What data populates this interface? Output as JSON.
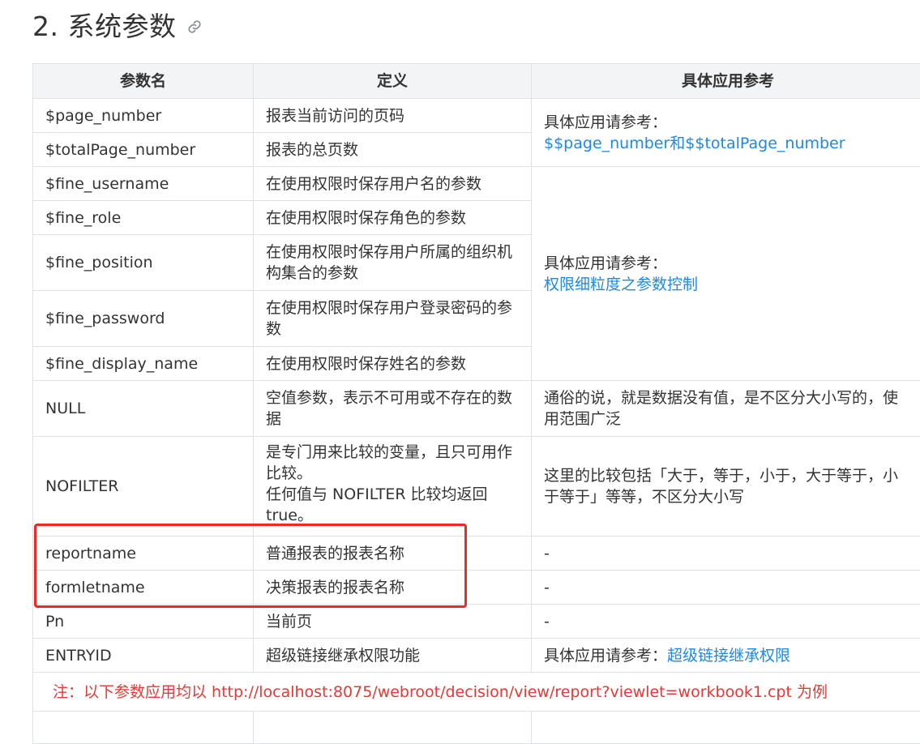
{
  "section": {
    "title": "2. 系统参数",
    "anchor_icon": "link-icon"
  },
  "table": {
    "headers": [
      "参数名",
      "定义",
      "具体应用参考"
    ],
    "refs": {
      "page": {
        "label": "具体应用请参考：",
        "link": "$$page_number和$$totalPage_number"
      },
      "fine": {
        "label": "具体应用请参考：",
        "link": "权限细粒度之参数控制"
      },
      "null": "通俗的说，就是数据没有值，是不区分大小写的，使用范围广泛",
      "nofilter": "这里的比较包括「大于，等于，小于，大于等于，小于等于」等等，不区分大小写",
      "reportname": "-",
      "formletname": "-",
      "pn": "-",
      "entryid": {
        "label": "具体应用请参考：",
        "link": "超级链接继承权限"
      }
    },
    "rows": [
      {
        "name": "$page_number",
        "def": "报表当前访问的页码"
      },
      {
        "name": "$totalPage_number",
        "def": "报表的总页数"
      },
      {
        "name": "$fine_username",
        "def": "在使用权限时保存用户名的参数"
      },
      {
        "name": "$fine_role",
        "def": "在使用权限时保存角色的参数"
      },
      {
        "name": "$fine_position",
        "def": "在使用权限时保存用户所属的组织机构集合的参数"
      },
      {
        "name": "$fine_password",
        "def": "在使用权限时保存用户登录密码的参数"
      },
      {
        "name": "$fine_display_name",
        "def": "在使用权限时保存姓名的参数"
      },
      {
        "name": "NULL",
        "def": "空值参数，表示不可用或不存在的数据"
      },
      {
        "name": "NOFILTER",
        "def_line1": "是专门用来比较的变量，且只可用作比较。",
        "def_line2": "任何值与 NOFILTER 比较均返回 true。"
      },
      {
        "name": "reportname",
        "def": "普通报表的报表名称"
      },
      {
        "name": "formletname",
        "def": "决策报表的报表名称"
      },
      {
        "name": "Pn",
        "def": "当前页"
      },
      {
        "name": "ENTRYID",
        "def": "超级链接继承权限功能"
      }
    ],
    "note": "注：以下参数应用均以 http://localhost:8075/webroot/decision/view/report?viewlet=workbook1.cpt  为例"
  },
  "colors": {
    "link": "#1e88e5",
    "highlight_box": "#ee2a24",
    "note_text": "#e53935",
    "header_bg": "#f3f4f6",
    "border": "#dfe2e5"
  }
}
